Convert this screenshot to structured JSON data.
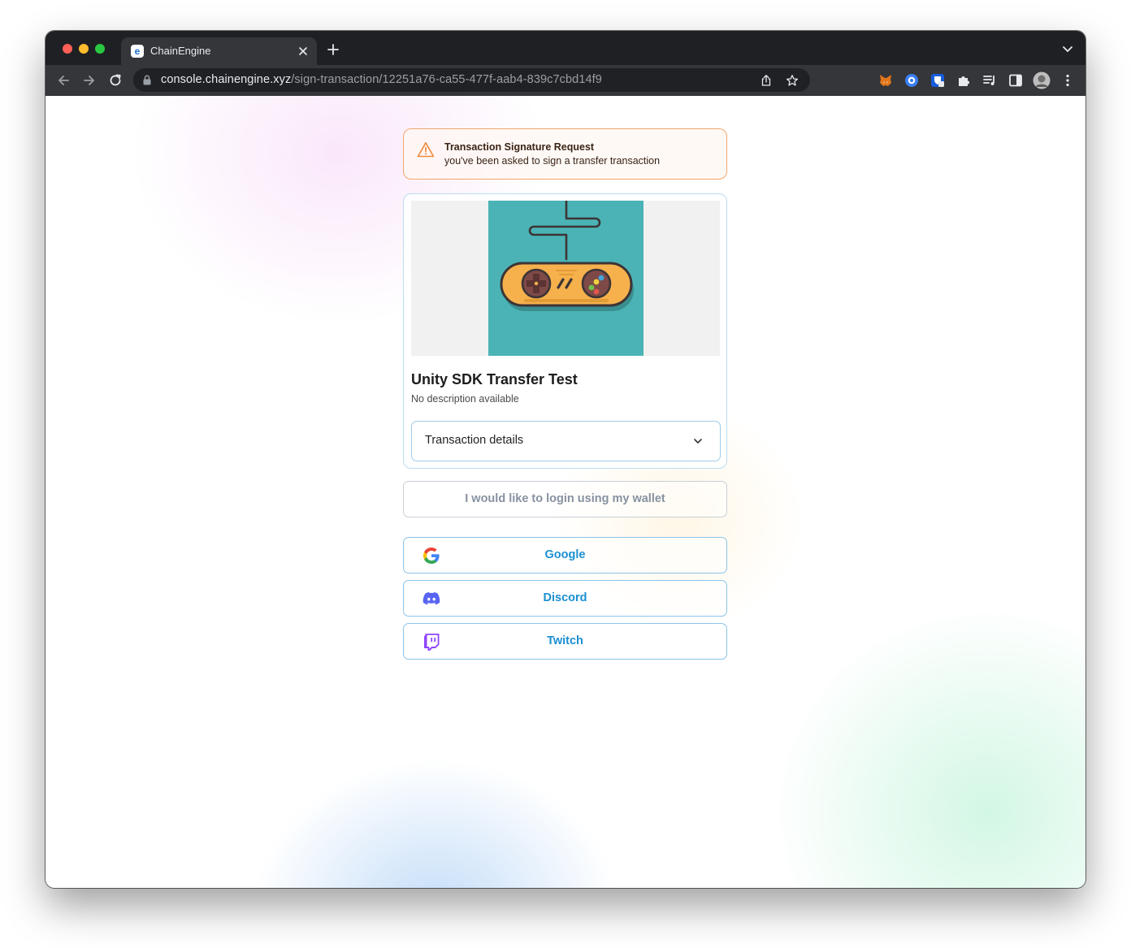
{
  "browser": {
    "tab_title": "ChainEngine",
    "tab_favicon": "e",
    "url_host": "console.chainengine.xyz",
    "url_path": "/sign-transaction/12251a76-ca55-477f-aab4-839c7cbd14f9",
    "icons": [
      "close-icon",
      "plus-icon",
      "chevron-down-icon",
      "back-arrow-icon",
      "forward-arrow-icon",
      "reload-icon",
      "lock-icon",
      "share-icon",
      "star-icon",
      "metamask-fox-icon",
      "extension-circle-icon",
      "extension-shield-icon",
      "puzzle-icon",
      "media-queue-icon",
      "side-panel-icon",
      "profile-avatar-icon",
      "more-vert-icon"
    ]
  },
  "alert": {
    "title": "Transaction Signature Request",
    "text": "you've been asked to sign a transfer transaction",
    "icon": "warning-triangle-icon",
    "color": "#f2a66b"
  },
  "item": {
    "title": "Unity SDK Transfer Test",
    "description": "No description available",
    "image": "gamepad-illustration",
    "image_bg": "#4bb3b5",
    "details_label": "Transaction details"
  },
  "login": {
    "wallet_label": "I would like to login using my wallet",
    "providers": [
      {
        "label": "Google",
        "icon": "google-icon"
      },
      {
        "label": "Discord",
        "icon": "discord-icon",
        "color": "#5865f2"
      },
      {
        "label": "Twitch",
        "icon": "twitch-icon",
        "color": "#9146ff"
      }
    ],
    "accent": "#1b8fd2"
  }
}
